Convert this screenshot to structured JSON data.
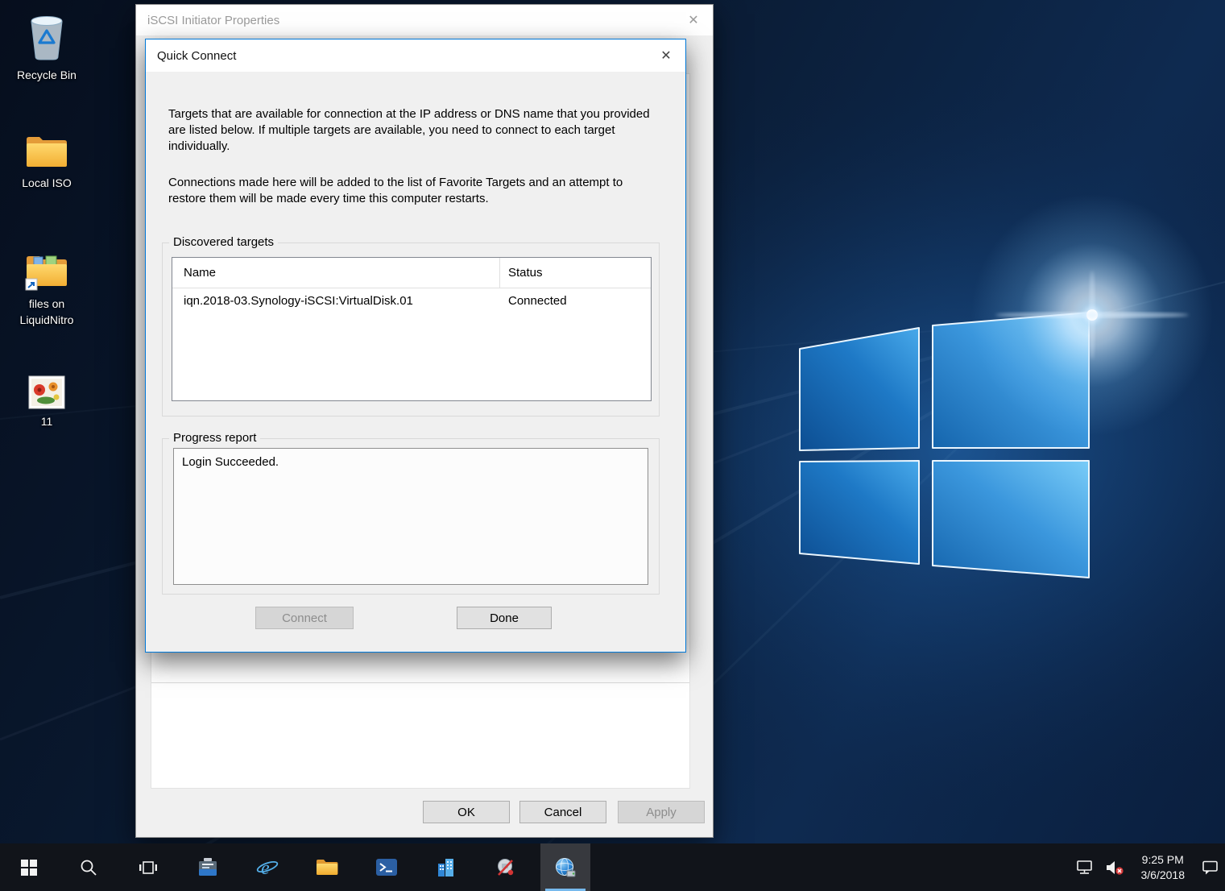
{
  "icons": {
    "close": "✕"
  },
  "desktop": {
    "icons": [
      {
        "label": "Recycle Bin"
      },
      {
        "label": "Local ISO"
      },
      {
        "label": "files on LiquidNitro"
      },
      {
        "label": "11"
      }
    ]
  },
  "parent_dialog": {
    "title": "iSCSI Initiator Properties",
    "ok": "OK",
    "cancel": "Cancel",
    "apply": "Apply"
  },
  "quick_connect": {
    "title": "Quick Connect",
    "para1": "Targets that are available for connection at the IP address or DNS name that you provided are listed below.  If multiple targets are available, you need to connect to each target individually.",
    "para2": "Connections made here will be added to the list of Favorite Targets and an attempt to restore them will be made every time this computer restarts.",
    "discovered_group": "Discovered targets",
    "columns": {
      "name": "Name",
      "status": "Status"
    },
    "targets": [
      {
        "name": "iqn.2018-03.Synology-iSCSI:VirtualDisk.01",
        "status": "Connected"
      }
    ],
    "progress_group": "Progress report",
    "progress_text": "Login Succeeded.",
    "connect": "Connect",
    "done": "Done"
  },
  "taskbar": {
    "time": "9:25 PM",
    "date": "3/6/2018"
  }
}
